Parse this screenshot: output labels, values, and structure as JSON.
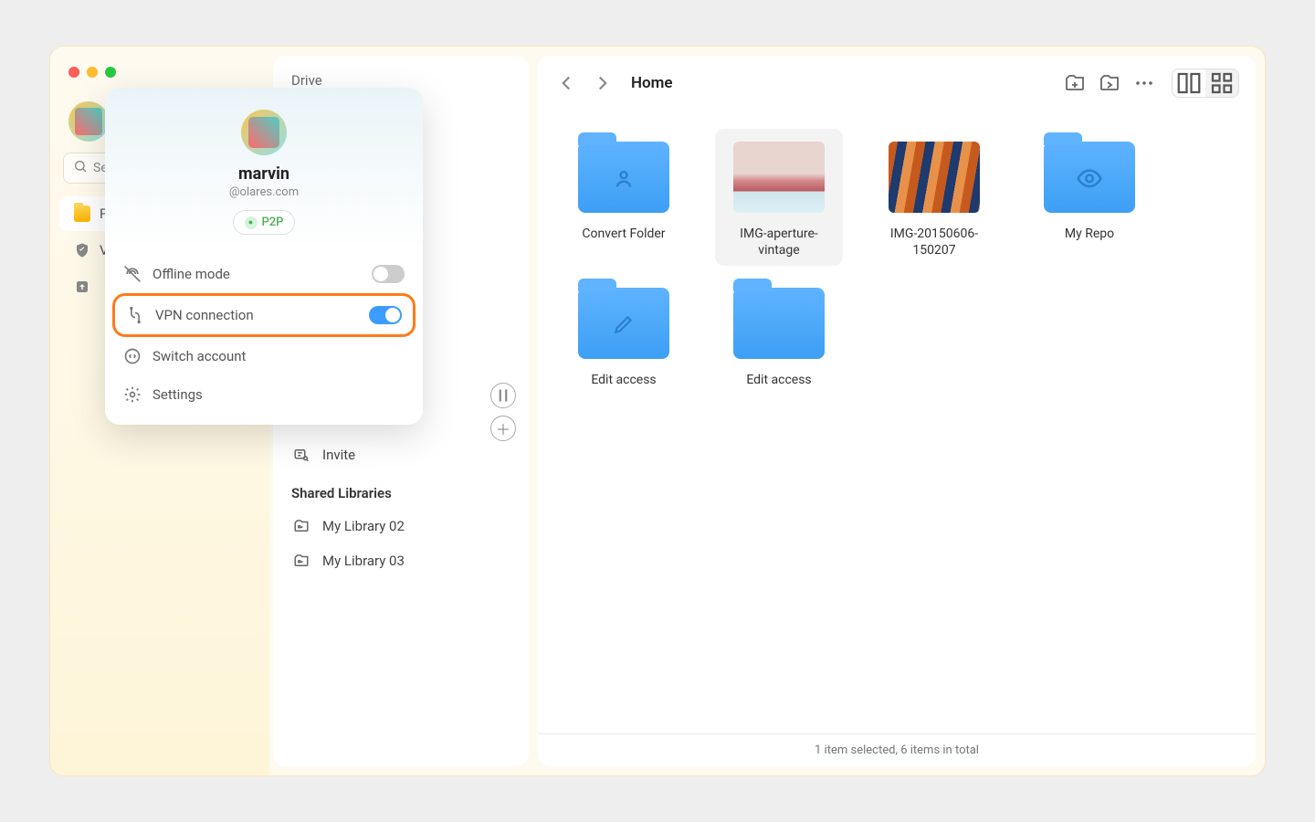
{
  "window_title": "Drive",
  "search_placeholder": "Sea",
  "rail": {
    "item_p": "F",
    "item_v": "V",
    "item_u": ""
  },
  "popup": {
    "username": "marvin",
    "domain": "@olares.com",
    "badge": "P2P",
    "offline_label": "Offline mode",
    "vpn_label": "VPN connection",
    "switch_label": "Switch account",
    "settings_label": "Settings"
  },
  "mid": {
    "invite": "Invite",
    "shared_header": "Shared Libraries",
    "libs": [
      "My Library 02",
      "My Library 03"
    ]
  },
  "breadcrumb": "Home",
  "items": [
    {
      "name": "Convert Folder",
      "type": "folder",
      "icon": "person"
    },
    {
      "name": "IMG-aperture-vintage",
      "type": "image",
      "variant": "img1"
    },
    {
      "name": "IMG-20150606-150207",
      "type": "image",
      "variant": "img2"
    },
    {
      "name": "My Repo",
      "type": "folder",
      "icon": "eye"
    },
    {
      "name": "Edit access",
      "type": "folder",
      "icon": "pencil"
    },
    {
      "name": "Edit access",
      "type": "folder",
      "icon": ""
    }
  ],
  "status": "1 item selected, 6 items in total"
}
